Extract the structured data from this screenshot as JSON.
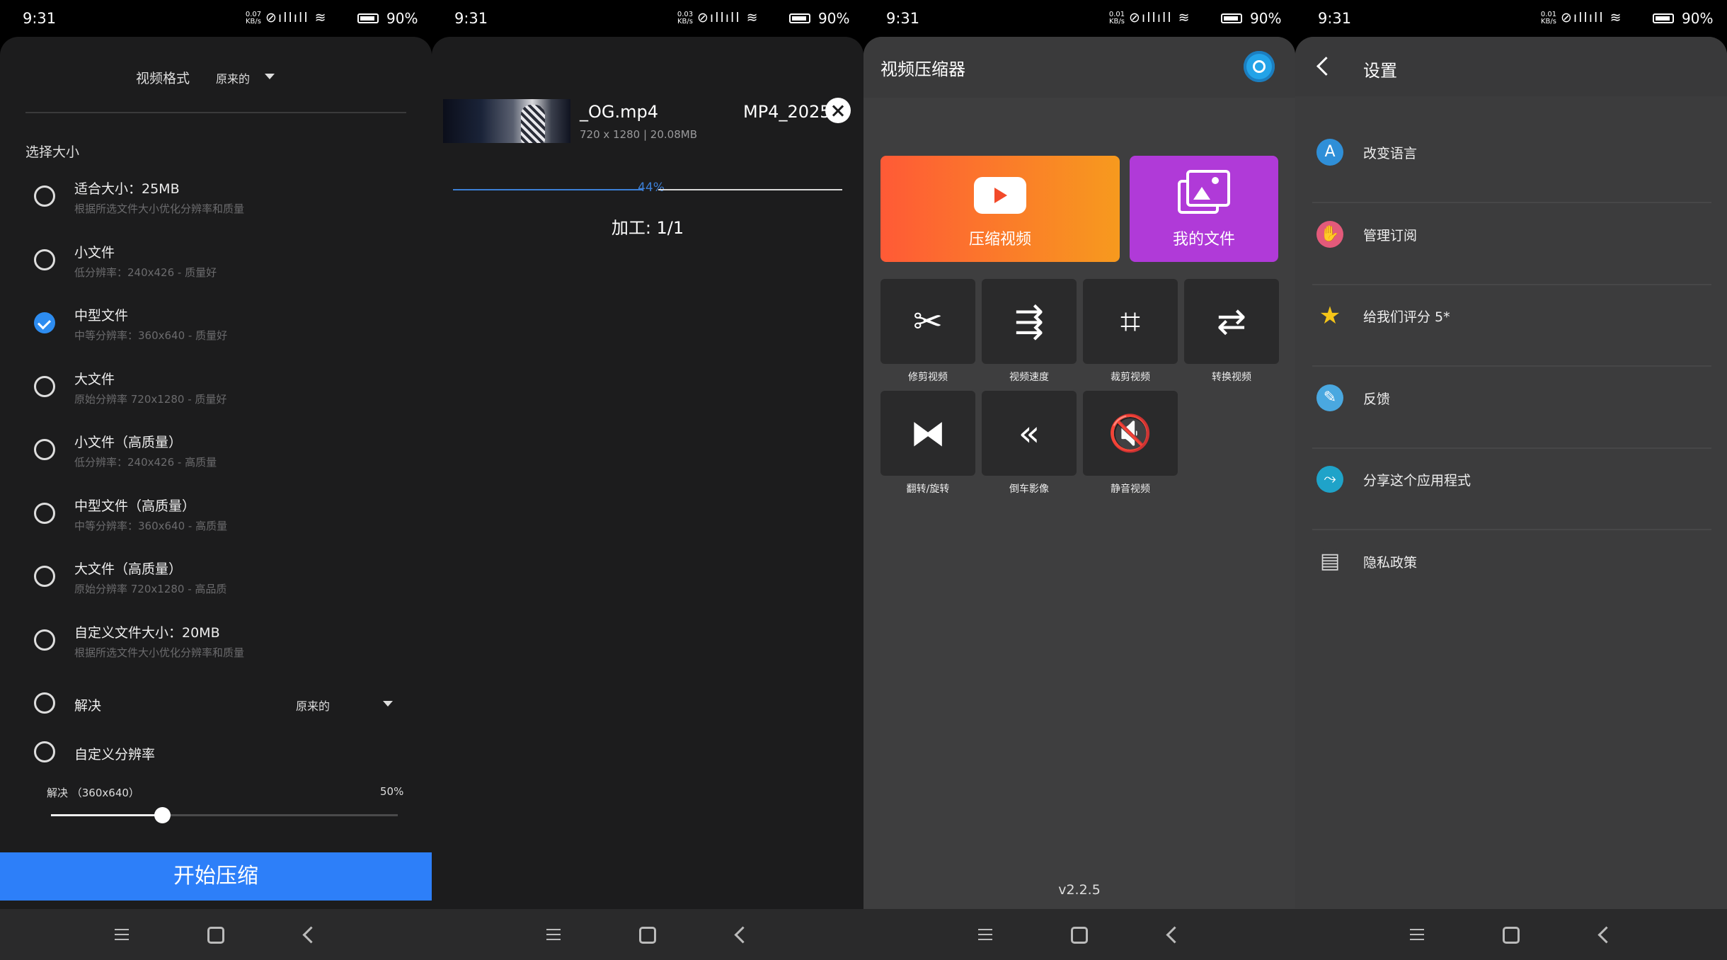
{
  "status": [
    {
      "time": "9:31",
      "speed_top": "0.07",
      "speed_unit": "KB/s",
      "battery": "90%",
      "battery_level": 0.9
    },
    {
      "time": "9:31",
      "speed_top": "0.03",
      "speed_unit": "KB/s",
      "battery": "90%",
      "battery_level": 0.9
    },
    {
      "time": "9:31",
      "speed_top": "0.01",
      "speed_unit": "KB/s",
      "battery": "90%",
      "battery_level": 0.9
    },
    {
      "time": "9:31",
      "speed_top": "0.01",
      "speed_unit": "KB/s",
      "battery": "90%",
      "battery_level": 0.9
    }
  ],
  "status_icons": "⊘ıllıll ≋",
  "screen1": {
    "format_label": "视频格式",
    "format_value": "原来的",
    "section_title": "选择大小",
    "options": [
      {
        "title": "适合大小：25MB",
        "subtitle": "根据所选文件大小优化分辨率和质量",
        "checked": false
      },
      {
        "title": "小文件",
        "subtitle": "低分辨率：240x426 - 质量好",
        "checked": false
      },
      {
        "title": "中型文件",
        "subtitle": "中等分辨率：360x640 - 质量好",
        "checked": true
      },
      {
        "title": "大文件",
        "subtitle": "原始分辨率 720x1280 - 质量好",
        "checked": false
      },
      {
        "title": "小文件（高质量）",
        "subtitle": "低分辨率：240x426 - 高质量",
        "checked": false
      },
      {
        "title": "中型文件（高质量）",
        "subtitle": "中等分辨率：360x640 - 高质量",
        "checked": false
      },
      {
        "title": "大文件（高质量）",
        "subtitle": "原始分辨率 720x1280 - 高品质",
        "checked": false
      },
      {
        "title": "自定义文件大小：20MB",
        "subtitle": "根据所选文件大小优化分辨率和质量",
        "checked": false
      }
    ],
    "resolution_label": "解决",
    "resolution_value": "原来的",
    "custom_resolution_label": "自定义分辨率",
    "slider_label": "解决 （360x640）",
    "slider_value": "50%",
    "slider_fraction": 0.5,
    "start_button": "开始压缩"
  },
  "screen2": {
    "file_name": "_OG.mp4",
    "file_meta": "720 x 1280 | 20.08MB",
    "file_name_2": "MP4_2025",
    "progress_label": "44%",
    "progress_fraction": 0.44,
    "processing": "加工: 1/1"
  },
  "screen3": {
    "title": "视频压缩器",
    "compress_label": "压缩视频",
    "files_label": "我的文件",
    "tools": [
      {
        "label": "修剪视频",
        "icon": "scissors-icon",
        "glyph": "✂"
      },
      {
        "label": "视频速度",
        "icon": "running-icon",
        "glyph": "⇶"
      },
      {
        "label": "裁剪视频",
        "icon": "crop-icon",
        "glyph": "⌗"
      },
      {
        "label": "转换视频",
        "icon": "convert-icon",
        "glyph": "⇄"
      },
      {
        "label": "翻转/旋转",
        "icon": "flip-icon",
        "glyph": "⧓"
      },
      {
        "label": "倒车影像",
        "icon": "rewind-icon",
        "glyph": "«"
      },
      {
        "label": "静音视频",
        "icon": "mute-icon",
        "glyph": "🔇"
      }
    ],
    "version": "v2.2.5"
  },
  "screen4": {
    "title": "设置",
    "items": [
      {
        "label": "改变语言",
        "icon": "language-icon",
        "glyph": "A",
        "color": "#2f8fd8"
      },
      {
        "label": "管理订阅",
        "icon": "subscription-icon",
        "glyph": "✋",
        "color": "#e35a7a"
      },
      {
        "label": "给我们评分 5*",
        "icon": "star-icon",
        "glyph": "★",
        "color": "#3c3c3d"
      },
      {
        "label": "反馈",
        "icon": "feedback-icon",
        "glyph": "✎",
        "color": "#4aa8e0"
      },
      {
        "label": "分享这个应用程式",
        "icon": "share-icon",
        "glyph": "⤳",
        "color": "#1fa3c9"
      },
      {
        "label": "隐私政策",
        "icon": "privacy-icon",
        "glyph": "▤",
        "color": "#3c3c3d"
      }
    ]
  }
}
